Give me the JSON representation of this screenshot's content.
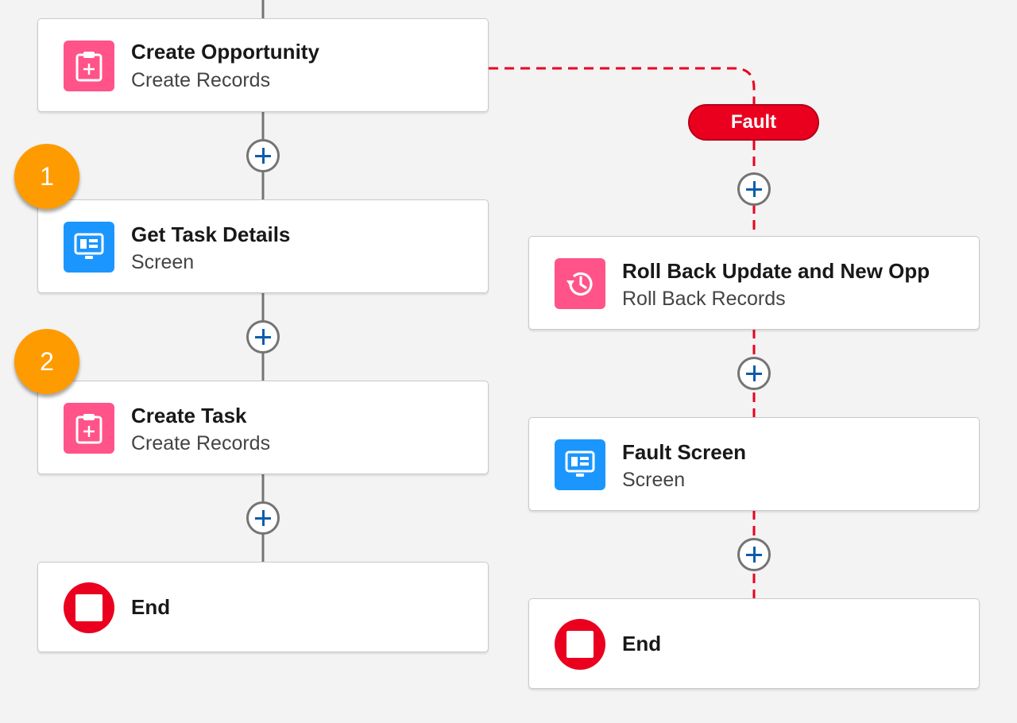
{
  "main_path": {
    "create_opportunity": {
      "title": "Create Opportunity",
      "subtitle": "Create Records",
      "icon": "create-records-icon"
    },
    "get_task_details": {
      "title": "Get Task Details",
      "subtitle": "Screen",
      "icon": "screen-icon"
    },
    "create_task": {
      "title": "Create Task",
      "subtitle": "Create Records",
      "icon": "create-records-icon"
    },
    "end": {
      "title": "End",
      "icon": "end-icon"
    }
  },
  "fault_path": {
    "label": "Fault",
    "roll_back": {
      "title": "Roll Back Update and New Opp",
      "subtitle": "Roll Back Records",
      "icon": "roll-back-icon"
    },
    "fault_screen": {
      "title": "Fault Screen",
      "subtitle": "Screen",
      "icon": "screen-icon"
    },
    "end": {
      "title": "End",
      "icon": "end-icon"
    }
  },
  "callouts": [
    "1",
    "2"
  ],
  "colors": {
    "create_records": "#ff538a",
    "screen": "#1b96ff",
    "end": "#ea001e",
    "fault": "#ea001e",
    "callout": "#fe9b00",
    "add_button_plus": "#0b5cab"
  }
}
